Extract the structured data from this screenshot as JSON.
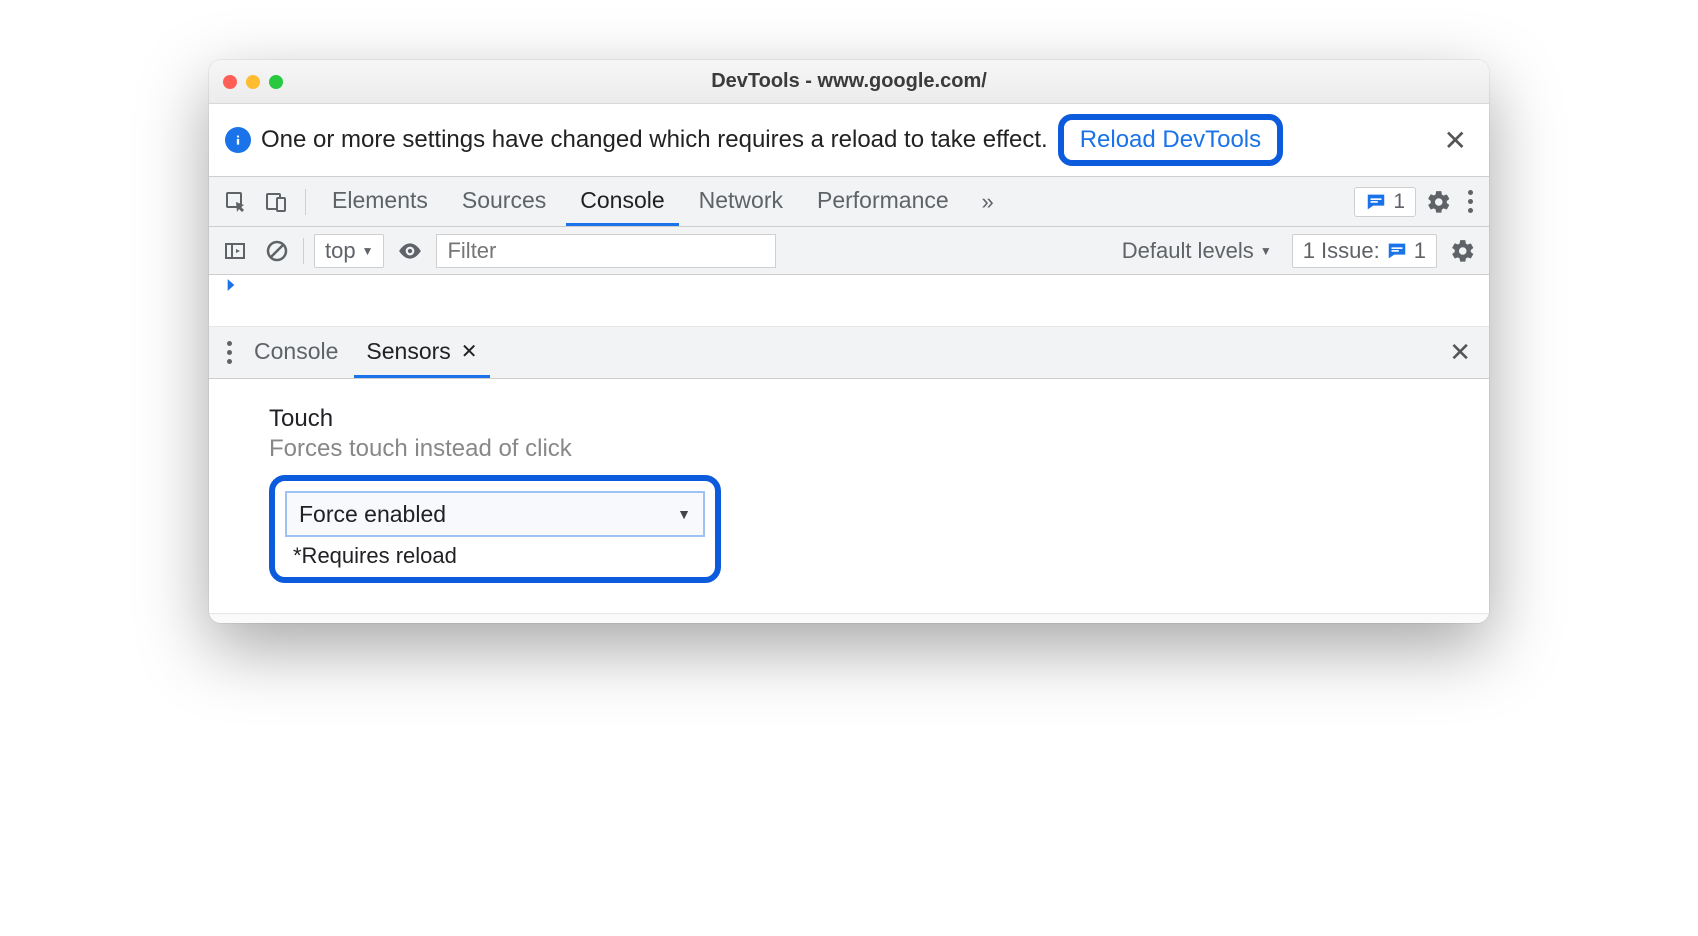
{
  "window": {
    "title": "DevTools - www.google.com/"
  },
  "infobar": {
    "message": "One or more settings have changed which requires a reload to take effect.",
    "button": "Reload DevTools"
  },
  "tabs": {
    "items": [
      "Elements",
      "Sources",
      "Console",
      "Network",
      "Performance"
    ],
    "activeIndex": 2,
    "issueCount": "1"
  },
  "filterbar": {
    "context": "top",
    "filterPlaceholder": "Filter",
    "levels": "Default levels",
    "issues": "1 Issue:",
    "issueCount": "1"
  },
  "drawer": {
    "tabs": [
      "Console",
      "Sensors"
    ],
    "activeIndex": 1
  },
  "sensors": {
    "touchLabel": "Touch",
    "touchDescription": "Forces touch instead of click",
    "touchValue": "Force enabled",
    "reloadNote": "*Requires reload"
  }
}
